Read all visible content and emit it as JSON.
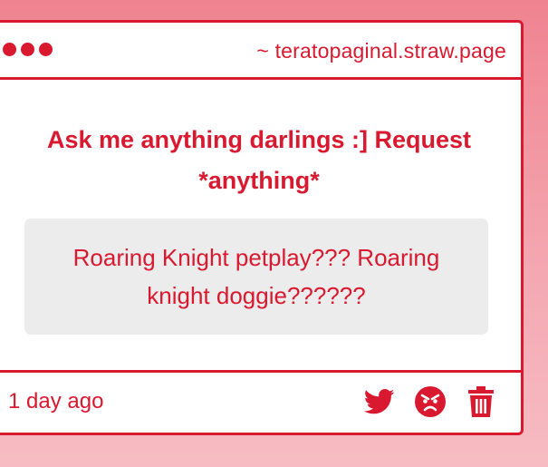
{
  "window": {
    "url": "~ teratopaginal.straw.page"
  },
  "post": {
    "question": "Ask me anything darlings :] Request *anything*",
    "answer": "Roaring Knight petplay??? Roaring knight doggie??????",
    "timestamp": "1 day ago"
  },
  "icons": {
    "share": "twitter-icon",
    "react": "angry-face-icon",
    "delete": "trash-icon"
  },
  "colors": {
    "accent": "#d8192f",
    "answer_bg": "#ececec",
    "background": "#f08390"
  }
}
